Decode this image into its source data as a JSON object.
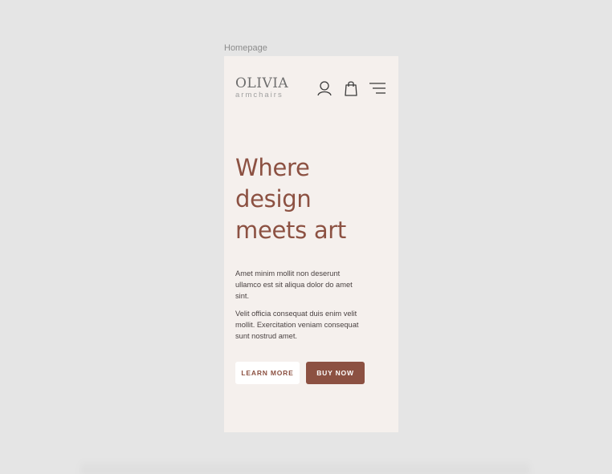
{
  "canvas": {
    "frame_label": "Homepage"
  },
  "header": {
    "logo_main": "OLIVIA",
    "logo_sub": "armchairs",
    "icons": [
      "user-icon",
      "shopping-bag-icon",
      "menu-icon"
    ]
  },
  "hero": {
    "title_lines": [
      "Where",
      "design",
      "meets art"
    ],
    "paragraph_1": "Amet minim mollit non deserunt ullamco est sit aliqua dolor do amet sint.",
    "paragraph_2": "Velit officia consequat duis enim velit mollit. Exercitation veniam consequat sunt nostrud amet.",
    "learn_more_label": "LEARN MORE",
    "buy_now_label": "BUY NOW"
  },
  "colors": {
    "canvas_bg": "#e5e5e5",
    "frame_bg": "#f5f0ed",
    "accent": "#8c5142",
    "body_text": "#4a4242"
  }
}
